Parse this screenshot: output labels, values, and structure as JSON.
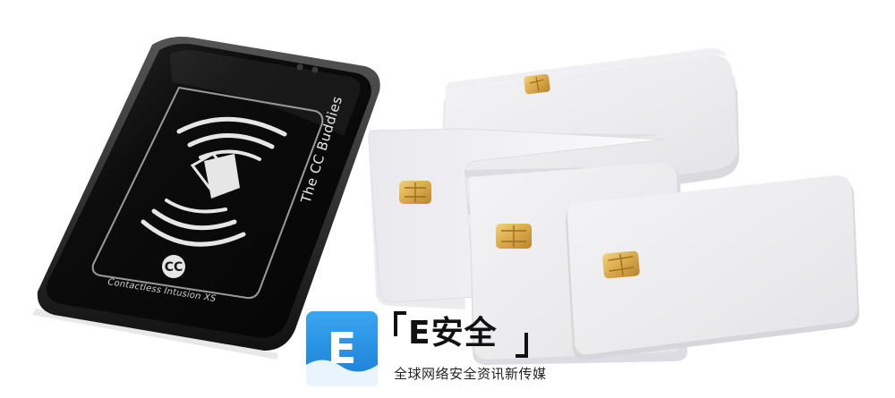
{
  "reader": {
    "brand": "The CC Buddies",
    "model": "Contactless Intusion XS",
    "badge": "CC"
  },
  "cards": {
    "count_visible": 4
  },
  "watermark": {
    "tile_letter": "E",
    "brand_text": "E安全",
    "tagline": "全球网络安全资讯新传媒",
    "colors": {
      "tile_top": "#3aa6f0",
      "tile_bottom": "#1b7fd6",
      "text": "#111111"
    }
  }
}
